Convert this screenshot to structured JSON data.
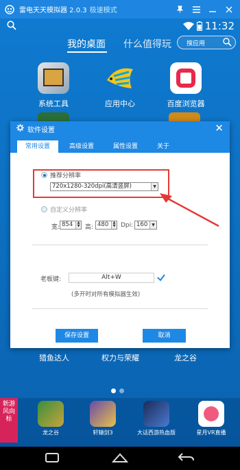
{
  "titlebar": {
    "app_name": "雷电天天模拟器 2.0.3",
    "mode": "极速模式"
  },
  "statusbar": {
    "time": "11:32"
  },
  "nav": {
    "tab_desktop": "我的桌面",
    "tab_recommend": "什么值得玩",
    "search_placeholder": "搜应用"
  },
  "apps_row1": [
    {
      "label": "系统工具",
      "icon": "system-tools-icon"
    },
    {
      "label": "应用中心",
      "icon": "app-center-icon"
    },
    {
      "label": "百度浏览器",
      "icon": "baidu-browser-icon"
    }
  ],
  "dialog": {
    "title": "软件设置",
    "tabs": [
      "常用设置",
      "高级设置",
      "属性设置",
      "关于"
    ],
    "recommended_label": "推荐分辨率",
    "recommended_value": "720x1280-320dpi(高清竖屏)",
    "custom_label": "自定义分辨率",
    "width_label": "宽:",
    "width_value": "854",
    "height_label": "高:",
    "height_value": "480",
    "dpi_label": "Dpi:",
    "dpi_value": "160",
    "boss_key_label": "老板键:",
    "boss_key_value": "Alt+W",
    "boss_key_note": "(多开时对所有模拟器生效)",
    "save_button": "保存设置",
    "cancel_button": "取消"
  },
  "apps_row2": [
    "猎鱼达人",
    "权力与荣耀",
    "龙之谷"
  ],
  "dock": {
    "ribbon": "新游风向标",
    "apps": [
      "龙之谷",
      "轩辕剑3",
      "大话西游热血版",
      "星月VR直播"
    ]
  },
  "colors": {
    "accent": "#1e88e5",
    "highlight": "#e53935",
    "ribbon": "#d6245b"
  }
}
